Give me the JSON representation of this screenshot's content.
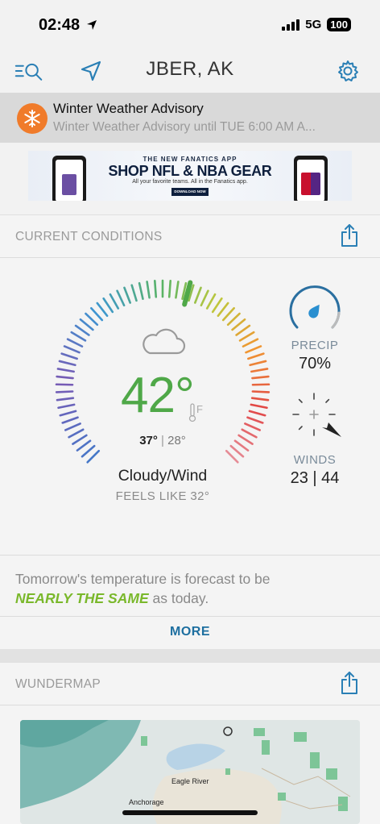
{
  "status": {
    "time": "02:48",
    "network": "5G",
    "battery": "100"
  },
  "header": {
    "title": "JBER, AK",
    "left_icons": [
      "search-list-icon",
      "location-arrow-icon"
    ],
    "right_icon": "gear-icon"
  },
  "advisory": {
    "title": "Winter Weather Advisory",
    "subtitle": "Winter Weather Advisory until TUE 6:00 AM A...",
    "icon": "snowflake-icon",
    "color": "#f07b2a"
  },
  "ad": {
    "kicker": "THE NEW FANATICS APP",
    "headline": "SHOP NFL & NBA GEAR",
    "sub": "All your favorite teams. All in the Fanatics app.",
    "button": "DOWNLOAD NOW"
  },
  "current": {
    "section_title": "CURRENT CONDITIONS",
    "temperature": "42°",
    "unit": "F",
    "high": "37°",
    "low": "28°",
    "separator": "|",
    "condition": "Cloudy/Wind",
    "feels_like": "FEELS LIKE 32°",
    "precip_label": "PRECIP",
    "precip_value": "70%",
    "winds_label": "WINDS",
    "winds_value": "23 | 44",
    "accent_color": "#4fa848",
    "cloud_icon": "cloud-icon",
    "precip_icon": "raindrop-gauge-icon",
    "wind_icon": "compass-icon"
  },
  "forecast": {
    "text_lead": "Tomorrow's temperature is forecast to be",
    "highlight": "NEARLY THE SAME",
    "text_tail": " as today.",
    "more": "MORE"
  },
  "map": {
    "section_title": "WUNDERMAP",
    "labels": [
      "Eagle River",
      "Anchorage"
    ]
  }
}
